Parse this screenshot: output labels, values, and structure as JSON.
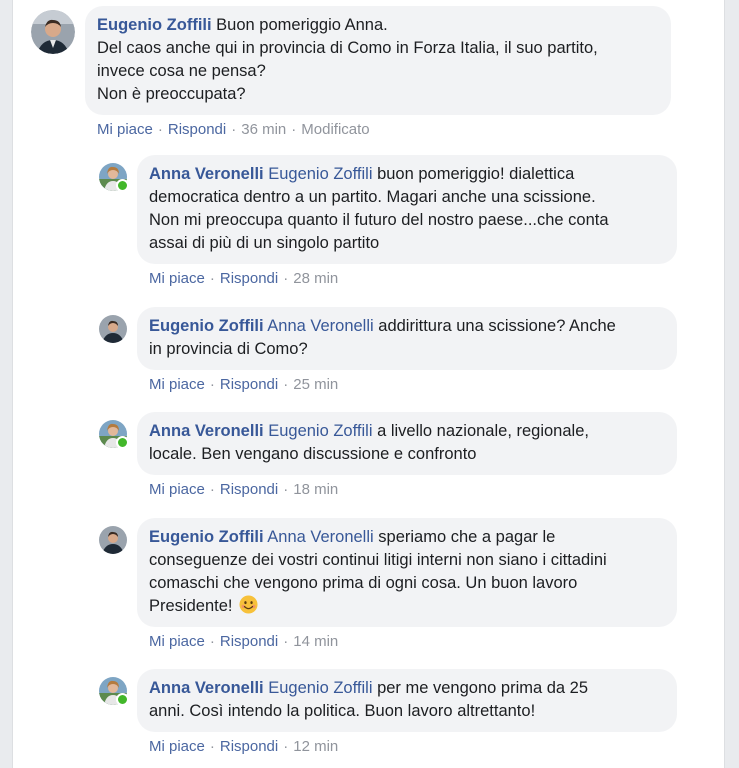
{
  "comments": [
    {
      "author": "Eugenio Zoffili",
      "mention": "",
      "text_lines": [
        "Buon pomeriggio Anna.",
        "Del caos anche qui in provincia di Como in Forza Italia, il suo partito,",
        "invece cosa ne pensa?",
        "Non è preoccupata?"
      ],
      "like": "Mi piace",
      "reply": "Rispondi",
      "time": "36 min",
      "edited": "Modificato"
    },
    {
      "author": "Anna Veronelli",
      "mention": "Eugenio Zoffili",
      "text_lines": [
        " buon pomeriggio! dialettica",
        "democratica dentro a un partito. Magari anche una scissione.",
        "Non mi preoccupa quanto il futuro del nostro paese...che conta",
        "assai di più di un singolo partito"
      ],
      "like": "Mi piace",
      "reply": "Rispondi",
      "time": "28 min"
    },
    {
      "author": "Eugenio Zoffili",
      "mention": "Anna Veronelli",
      "text_lines": [
        " addirittura una scissione? Anche",
        "in provincia di Como?"
      ],
      "like": "Mi piace",
      "reply": "Rispondi",
      "time": "25 min"
    },
    {
      "author": "Anna Veronelli",
      "mention": "Eugenio Zoffili",
      "text_lines": [
        " a livello nazionale, regionale,",
        "locale. Ben vengano discussione e confronto"
      ],
      "like": "Mi piace",
      "reply": "Rispondi",
      "time": "18 min"
    },
    {
      "author": "Eugenio Zoffili",
      "mention": "Anna Veronelli",
      "text_lines": [
        " speriamo che a pagar le",
        "conseguenze dei vostri continui litigi interni non siano i cittadini",
        "comaschi che vengono prima di ogni cosa. Un buon lavoro",
        "Presidente!"
      ],
      "emoji": "smiling-face-emoji",
      "like": "Mi piace",
      "reply": "Rispondi",
      "time": "14 min"
    },
    {
      "author": "Anna Veronelli",
      "mention": "Eugenio Zoffili",
      "text_lines": [
        " per me vengono prima da 25",
        "anni. Così intendo la politica. Buon lavoro altrettanto!"
      ],
      "like": "Mi piace",
      "reply": "Rispondi",
      "time": "12 min"
    }
  ],
  "colors": {
    "link": "#385898",
    "bubble": "#f2f3f5",
    "meta": "#90949c",
    "online": "#42b72a"
  }
}
